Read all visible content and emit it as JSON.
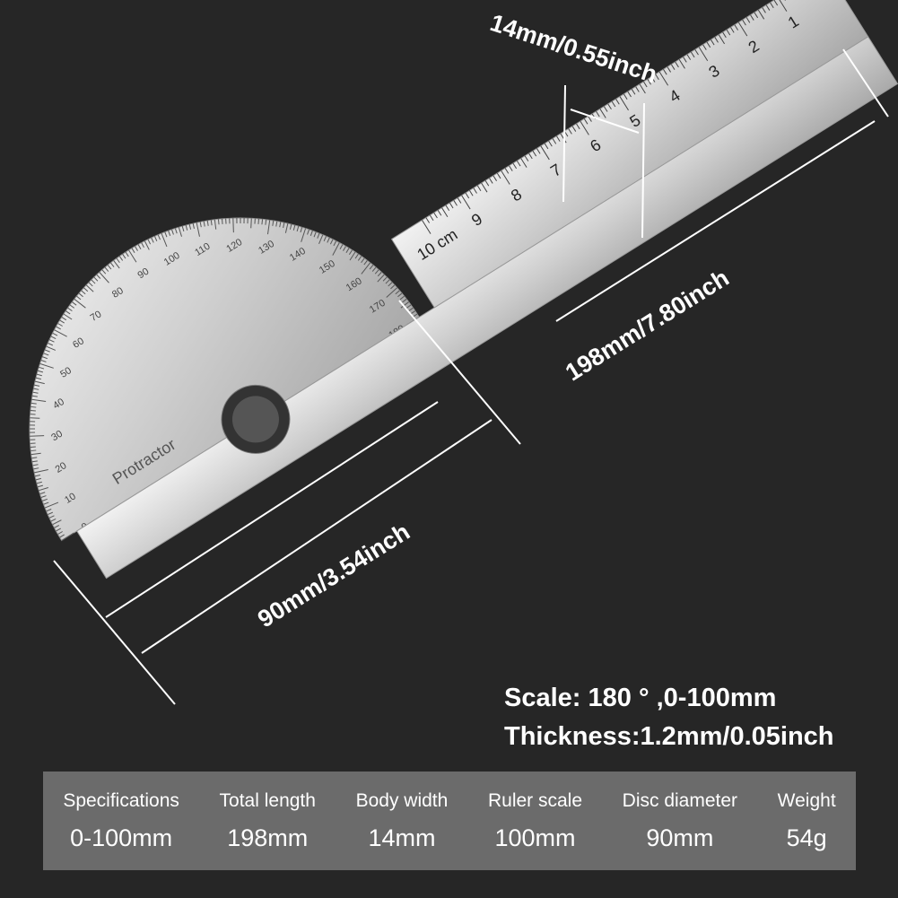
{
  "dimensions": {
    "body_width": "14mm/0.55inch",
    "total_length": "198mm/7.80inch",
    "disc_diameter": "90mm/3.54inch"
  },
  "protractor_label": "Protractor",
  "ruler_unit": "cm",
  "ruler_numbers": [
    "1",
    "2",
    "3",
    "4",
    "5",
    "6",
    "7",
    "8",
    "9",
    "10"
  ],
  "info": {
    "scale": "Scale: 180 °  ,0-100mm",
    "thickness": "Thickness:1.2mm/0.05inch"
  },
  "specs": [
    {
      "header": "Specifications",
      "value": "0-100mm"
    },
    {
      "header": "Total length",
      "value": "198mm"
    },
    {
      "header": "Body width",
      "value": "14mm"
    },
    {
      "header": "Ruler scale",
      "value": "100mm"
    },
    {
      "header": "Disc diameter",
      "value": "90mm"
    },
    {
      "header": "Weight",
      "value": "54g"
    }
  ],
  "colors": {
    "background": "#262626",
    "table": "#6b6b6b",
    "steel": "#d9d9d9"
  }
}
